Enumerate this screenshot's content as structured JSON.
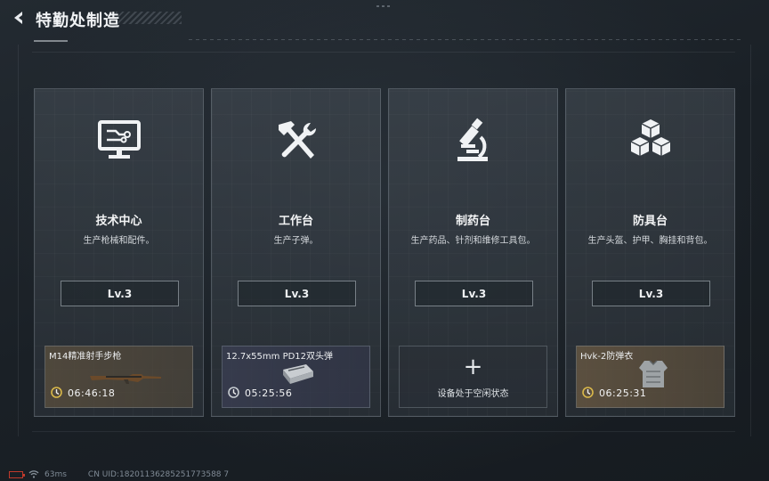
{
  "header": {
    "title": "特勤处制造",
    "back_icon": "back-arrow-icon"
  },
  "cards": [
    {
      "name": "技术中心",
      "desc": "生产枪械和配件。",
      "icon": "computer-icon",
      "level": "Lv.3",
      "slot": {
        "state": "busy",
        "item": "M14精准射手步枪",
        "time": "06:46:18",
        "bg": "wood"
      }
    },
    {
      "name": "工作台",
      "desc": "生产子弹。",
      "icon": "hammer-wrench-icon",
      "level": "Lv.3",
      "slot": {
        "state": "busy",
        "item": "12.7x55mm PD12双头弹",
        "time": "05:25:56",
        "bg": "blue"
      }
    },
    {
      "name": "制药台",
      "desc": "生产药品、针剂和维修工具包。",
      "icon": "microscope-icon",
      "level": "Lv.3",
      "slot": {
        "state": "idle",
        "plus": "+",
        "text": "设备处于空闲状态"
      }
    },
    {
      "name": "防具台",
      "desc": "生产头盔、护甲、胸挂和背包。",
      "icon": "boxes-icon",
      "level": "Lv.3",
      "slot": {
        "state": "busy",
        "item": "Hvk-2防弹衣",
        "time": "06:25:31",
        "bg": "brown"
      }
    }
  ],
  "footer": {
    "ping": "63ms",
    "uid": "CN UID:18201136285251773588 7"
  },
  "colors": {
    "accent": "#d9b84a",
    "battery": "#c0392b"
  }
}
